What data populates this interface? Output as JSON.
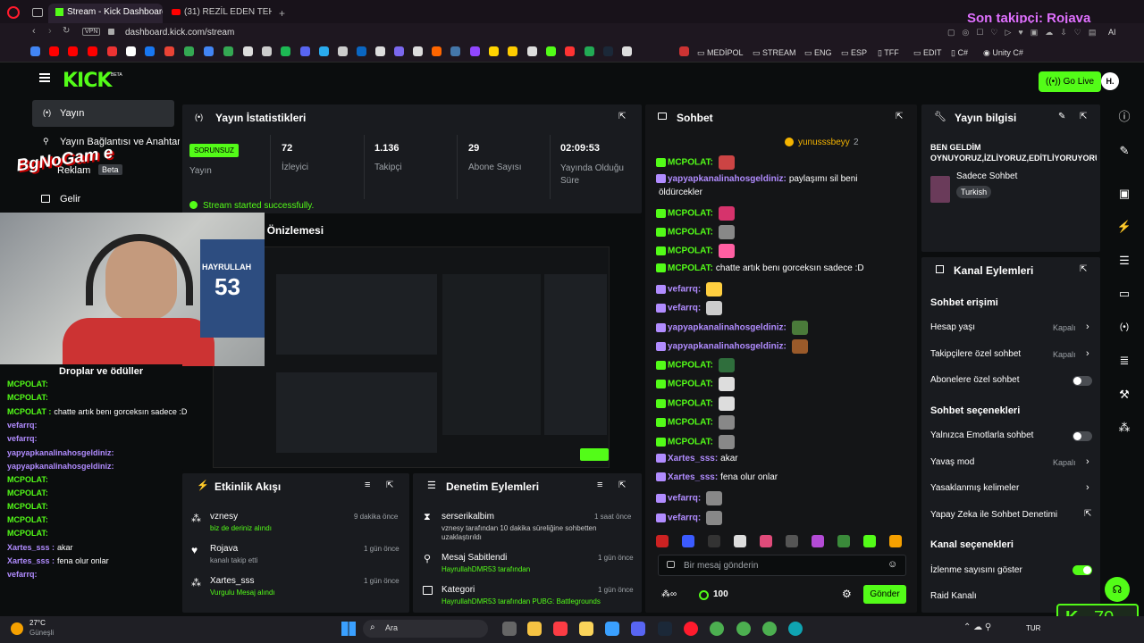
{
  "browser": {
    "tabs": [
      "Stream - Kick Dashboard",
      "(31) REZİL EDEN TEHLİKEL..."
    ],
    "url": "dashboard.kick.com/stream",
    "vpn": "VPN",
    "bookmarks": [
      "MEDİPOL",
      "STREAM",
      "ENG",
      "ESP",
      "TFF",
      "EDIT",
      "C#",
      "Unity C#"
    ]
  },
  "overlay": {
    "last_follower": "Son takipçi: Rojava",
    "kick_count": "70"
  },
  "header": {
    "logo": "KICK",
    "beta": "BETA",
    "go_live": "Go Live",
    "avatar": "H."
  },
  "sidebar": {
    "items": [
      "Yayın",
      "Yayın Bağlantısı ve Anahtar",
      "Reklam",
      "Gelir"
    ],
    "beta": "Beta"
  },
  "stats": {
    "title": "Yayın İstatistikleri",
    "status": "SORUNSUZ",
    "status_label": "Yayın",
    "viewers": "72",
    "viewers_label": "İzleyici",
    "followers": "1.136",
    "followers_label": "Takipçi",
    "subs": "29",
    "subs_label": "Abone Sayısı",
    "duration": "02:09:53",
    "duration_label": "Yayında Olduğu Süre",
    "success": "Stream started successfully."
  },
  "preview": {
    "title": "Yayın Önizlemesi"
  },
  "activity": {
    "title": "Etkinlik Akışı",
    "items": [
      {
        "user": "vznesy",
        "desc": "biz de deriniz alındı",
        "time": "9 dakika önce"
      },
      {
        "user": "Rojava",
        "desc": "kanalı takip etti",
        "time": "1 gün önce"
      },
      {
        "user": "Xartes_sss",
        "desc": "Vurgulu Mesaj alındı",
        "time": "1 gün önce"
      }
    ]
  },
  "moderation": {
    "title": "Denetim Eylemleri",
    "items": [
      {
        "title": "serserikalbim",
        "desc1": "vznesy tarafından 10 dakika süreliğine sohbetten",
        "desc2": "uzaklaştırıldı",
        "time": "1 saat önce"
      },
      {
        "title": "Mesaj Sabitlendi",
        "desc1": "HayrullahDMR53 tarafından",
        "desc2": "",
        "time": "1 gün önce"
      },
      {
        "title": "Kategori",
        "desc1": "HayrullahDMR53 tarafından PUBG: Battlegrounds",
        "desc2": "",
        "time": "1 gün önce"
      }
    ]
  },
  "chat": {
    "title": "Sohbet",
    "pinned_user": "yunusssbeyy",
    "pinned_count": "2",
    "messages": [
      {
        "user": "MCPOLAT:",
        "text": "",
        "color": "#53fc18"
      },
      {
        "user": "yapyapkanalinahosgeldiniz:",
        "text": "paylaşımı sil beni",
        "color": "#b18cff"
      },
      {
        "user": "",
        "text": "öldürcekler",
        "color": "#ffffff"
      },
      {
        "user": "MCPOLAT:",
        "text": "",
        "color": "#53fc18"
      },
      {
        "user": "MCPOLAT:",
        "text": "",
        "color": "#53fc18"
      },
      {
        "user": "MCPOLAT:",
        "text": "",
        "color": "#53fc18"
      },
      {
        "user": "MCPOLAT:",
        "text": "chatte artık benı gorceksın sadece :D",
        "color": "#53fc18"
      },
      {
        "user": "vefarrq:",
        "text": "",
        "color": "#b18cff"
      },
      {
        "user": "vefarrq:",
        "text": "",
        "color": "#b18cff"
      },
      {
        "user": "yapyapkanalinahosgeldiniz:",
        "text": "",
        "color": "#b18cff"
      },
      {
        "user": "yapyapkanalinahosgeldiniz:",
        "text": "",
        "color": "#b18cff"
      },
      {
        "user": "MCPOLAT:",
        "text": "",
        "color": "#53fc18"
      },
      {
        "user": "MCPOLAT:",
        "text": "",
        "color": "#53fc18"
      },
      {
        "user": "MCPOLAT:",
        "text": "",
        "color": "#53fc18"
      },
      {
        "user": "MCPOLAT:",
        "text": "",
        "color": "#53fc18"
      },
      {
        "user": "MCPOLAT:",
        "text": "",
        "color": "#53fc18"
      },
      {
        "user": "Xartes_sss:",
        "text": "akar",
        "color": "#b18cff"
      },
      {
        "user": "Xartes_sss:",
        "text": "fena olur onlar",
        "color": "#b18cff"
      },
      {
        "user": "vefarrq:",
        "text": "",
        "color": "#b18cff"
      },
      {
        "user": "vefarrq:",
        "text": "",
        "color": "#b18cff"
      }
    ],
    "placeholder": "Bir mesaj gönderin",
    "points": "100",
    "send": "Gönder"
  },
  "info": {
    "title": "Yayın bilgisi",
    "stream_title": "BEN GELDİM OYNUYORUZ,İZLİYORUZ,EDİTLİYORUYORU...",
    "category": "Sadece Sohbet",
    "language": "Turkish"
  },
  "actions": {
    "title": "Kanal Eylemleri",
    "chat_access": "Sohbet erişimi",
    "account_age": "Hesap yaşı",
    "account_age_val": "Kapalı",
    "followers_only": "Takipçilere özel sohbet",
    "followers_only_val": "Kapalı",
    "subs_only": "Abonelere özel sohbet",
    "chat_options": "Sohbet seçenekleri",
    "emote_only": "Yalnızca Emotlarla sohbet",
    "slow_mode": "Yavaş mod",
    "slow_mode_val": "Kapalı",
    "banned_words": "Yasaklanmış kelimeler",
    "ai_moderation": "Yapay Zeka ile Sohbet Denetimi",
    "channel_options": "Kanal seçenekleri",
    "show_viewers": "İzlenme sayısını göster",
    "raid": "Raid Kanalı"
  },
  "webcam": {
    "shirt_name": "HAYRULLAH",
    "shirt_number": "53",
    "watermark": "BgNoGam e"
  },
  "left_chat": {
    "header": "Droplar ve ödüller",
    "lines": [
      {
        "user": "MCPOLAT:",
        "text": "",
        "color": "#53fc18"
      },
      {
        "user": "MCPOLAT:",
        "text": "",
        "color": "#53fc18"
      },
      {
        "user": "MCPOLAT :",
        "text": "chatte artık benı gorceksın sadece :D",
        "color": "#53fc18"
      },
      {
        "user": "vefarrq:",
        "text": "",
        "color": "#b18cff"
      },
      {
        "user": "vefarrq:",
        "text": "",
        "color": "#b18cff"
      },
      {
        "user": "yapyapkanalinahosgeldiniz:",
        "text": "",
        "color": "#b18cff"
      },
      {
        "user": "yapyapkanalinahosgeldiniz:",
        "text": "",
        "color": "#b18cff"
      },
      {
        "user": "MCPOLAT:",
        "text": "",
        "color": "#53fc18"
      },
      {
        "user": "MCPOLAT:",
        "text": "",
        "color": "#53fc18"
      },
      {
        "user": "MCPOLAT:",
        "text": "",
        "color": "#53fc18"
      },
      {
        "user": "MCPOLAT:",
        "text": "",
        "color": "#53fc18"
      },
      {
        "user": "MCPOLAT:",
        "text": "",
        "color": "#53fc18"
      },
      {
        "user": "Xartes_sss :",
        "text": "akar",
        "color": "#b18cff"
      },
      {
        "user": "Xartes_sss :",
        "text": "fena olur onlar",
        "color": "#b18cff"
      },
      {
        "user": "vefarrq:",
        "text": "",
        "color": "#b18cff"
      },
      {
        "user": "vefarrq:",
        "text": "",
        "color": "#b18cff"
      }
    ]
  },
  "taskbar": {
    "weather": "27°C",
    "weather_desc": "Güneşli",
    "search": "Ara",
    "lang": "TUR"
  },
  "colors": {
    "accent": "#53fc18",
    "panel": "#191b1f",
    "bg": "#0b0d0e",
    "purple": "#b18cff"
  }
}
